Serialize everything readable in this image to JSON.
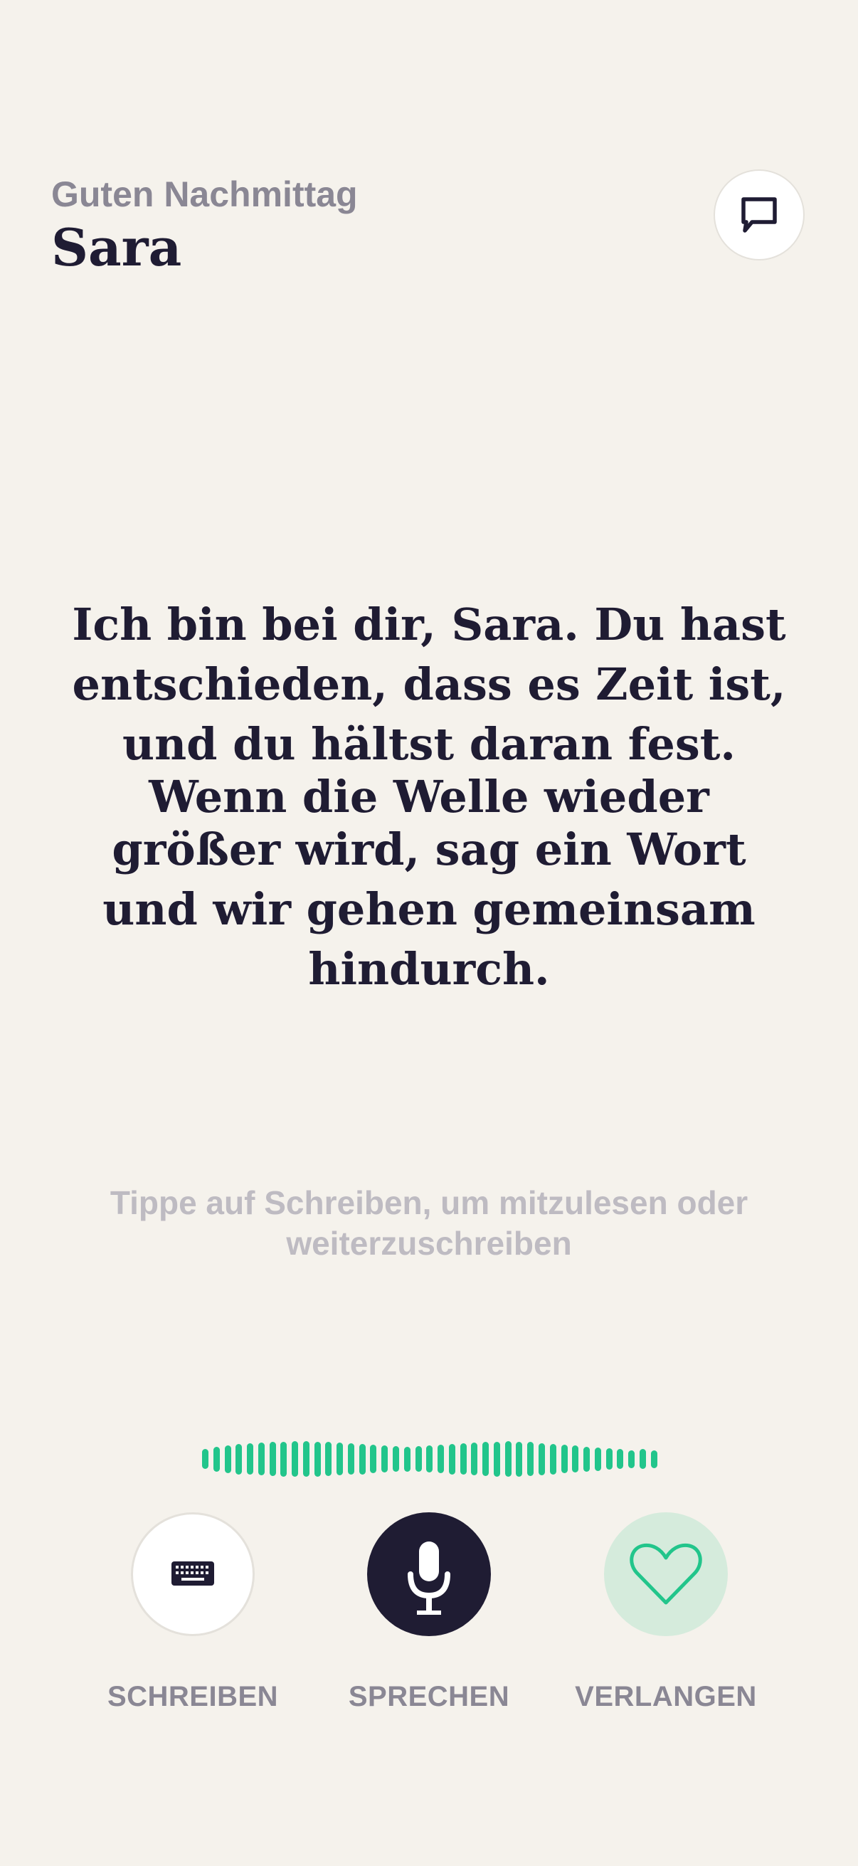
{
  "header": {
    "greeting": "Guten Nachmittag",
    "name": "Sara",
    "chat_icon": "chat-bubble-icon"
  },
  "message": {
    "lines": [
      "Ich bin bei dir, Sara. Du hast",
      "entschieden, dass es Zeit ist,",
      "und du hältst daran fest.",
      "Wenn die Welle wieder",
      "größer wird, sag ein Wort",
      "und wir gehen gemeinsam",
      "hindurch."
    ]
  },
  "hint": {
    "lines": [
      "Tippe auf Schreiben, um mitzulesen oder",
      "weiterzuschreiben"
    ]
  },
  "waveform": {
    "color": "#22c58b",
    "levels": [
      0.55,
      0.7,
      0.78,
      0.85,
      0.88,
      0.92,
      0.95,
      0.98,
      1.0,
      1.0,
      0.98,
      0.95,
      0.92,
      0.88,
      0.85,
      0.8,
      0.75,
      0.72,
      0.7,
      0.72,
      0.75,
      0.8,
      0.85,
      0.88,
      0.92,
      0.95,
      0.98,
      1.0,
      0.98,
      0.95,
      0.9,
      0.85,
      0.8,
      0.75,
      0.7,
      0.65,
      0.6,
      0.55,
      0.5,
      0.55,
      0.5
    ]
  },
  "actions": [
    {
      "label": "SCHREIBEN",
      "icon": "keyboard-icon"
    },
    {
      "label": "SPRECHEN",
      "icon": "microphone-icon"
    },
    {
      "label": "VERLANGEN",
      "icon": "heart-icon"
    }
  ],
  "colors": {
    "background": "#f5f2ec",
    "ink": "#1f1c33",
    "muted": "#8a8794",
    "accent": "#22c58b",
    "accent_soft": "#d5ebdc"
  }
}
